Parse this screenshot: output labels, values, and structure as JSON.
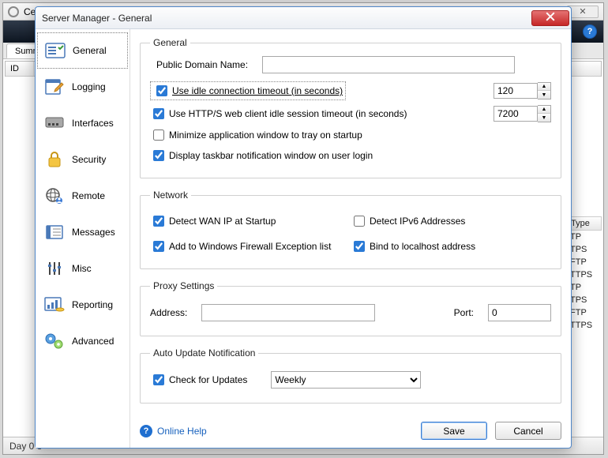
{
  "bg": {
    "title_prefix": "Cer",
    "close_glyph": "✕",
    "help_glyph": "?",
    "summary_tab": "Summa",
    "id_column": "ID",
    "status": "Day 0 o",
    "right_column": {
      "header": "Type",
      "rows": [
        "TP",
        "TPS",
        "FTP",
        "TTPS",
        "TP",
        "TPS",
        "FTP",
        "TTPS"
      ]
    }
  },
  "dialog": {
    "title": "Server Manager - General"
  },
  "sidebar": {
    "items": [
      {
        "label": "General"
      },
      {
        "label": "Logging"
      },
      {
        "label": "Interfaces"
      },
      {
        "label": "Security"
      },
      {
        "label": "Remote"
      },
      {
        "label": "Messages"
      },
      {
        "label": "Misc"
      },
      {
        "label": "Reporting"
      },
      {
        "label": "Advanced"
      }
    ]
  },
  "general": {
    "legend": "General",
    "public_domain_label": "Public Domain Name:",
    "public_domain_value": "",
    "idle_timeout": {
      "checked": true,
      "label": "Use idle connection timeout (in seconds)",
      "value": "120"
    },
    "http_timeout": {
      "checked": true,
      "label": "Use HTTP/S web client idle session timeout (in seconds)",
      "value": "7200"
    },
    "minimize_tray": {
      "checked": false,
      "label": "Minimize application window to tray on startup"
    },
    "taskbar_notify": {
      "checked": true,
      "label": "Display taskbar notification window on user login"
    }
  },
  "network": {
    "legend": "Network",
    "detect_wan": {
      "checked": true,
      "label": "Detect WAN IP at Startup"
    },
    "detect_ipv6": {
      "checked": false,
      "label": "Detect IPv6 Addresses"
    },
    "firewall": {
      "checked": true,
      "label": "Add to Windows Firewall Exception list"
    },
    "bind_localhost": {
      "checked": true,
      "label": "Bind to localhost address"
    }
  },
  "proxy": {
    "legend": "Proxy Settings",
    "address_label": "Address:",
    "address_value": "",
    "port_label": "Port:",
    "port_value": "0"
  },
  "update": {
    "legend": "Auto Update Notification",
    "check": {
      "checked": true,
      "label": "Check for Updates"
    },
    "frequency": "Weekly"
  },
  "footer": {
    "help": "Online Help",
    "save": "Save",
    "cancel": "Cancel"
  }
}
